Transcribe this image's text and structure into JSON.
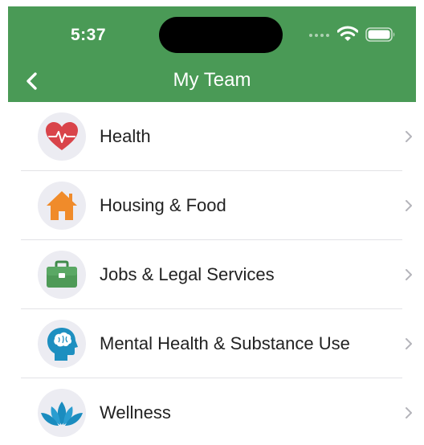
{
  "status_bar": {
    "time": "5:37"
  },
  "nav": {
    "title": "My Team",
    "back_icon": "chevron-left-icon"
  },
  "theme": {
    "header_color": "#4a9a56",
    "icon_background": "#ececf2"
  },
  "categories": [
    {
      "label": "Health",
      "icon": "heart-pulse-icon"
    },
    {
      "label": "Housing & Food",
      "icon": "house-icon"
    },
    {
      "label": "Jobs & Legal Services",
      "icon": "briefcase-icon"
    },
    {
      "label": "Mental Health & Substance Use",
      "icon": "head-brain-icon"
    },
    {
      "label": "Wellness",
      "icon": "lotus-icon"
    }
  ]
}
